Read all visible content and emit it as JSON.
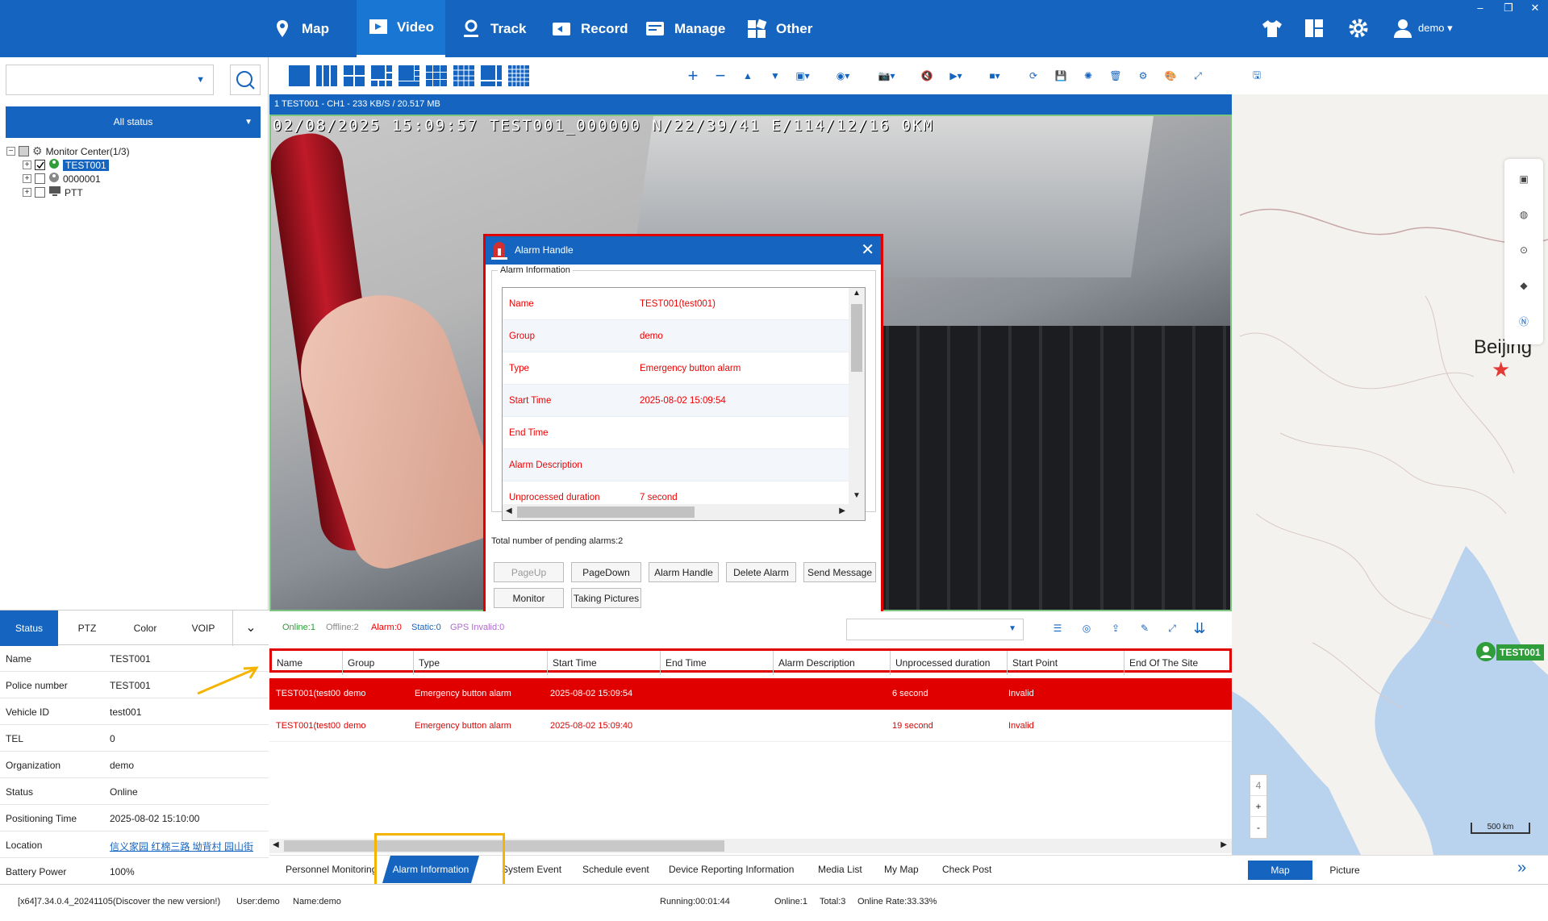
{
  "nav": {
    "map": "Map",
    "video": "Video",
    "track": "Track",
    "record": "Record",
    "manage": "Manage",
    "other": "Other",
    "user": "demo"
  },
  "left": {
    "status_select": "All status",
    "tree": {
      "root": "Monitor Center(1/3)",
      "items": [
        "TEST001",
        "0000001",
        "PTT"
      ]
    }
  },
  "leftTabs": [
    "Status",
    "PTZ",
    "Color",
    "VOIP"
  ],
  "info": [
    {
      "k": "Name",
      "v": "TEST001"
    },
    {
      "k": "Police number",
      "v": "TEST001"
    },
    {
      "k": "Vehicle ID",
      "v": "test001"
    },
    {
      "k": "TEL",
      "v": "0"
    },
    {
      "k": "Organization",
      "v": "demo"
    },
    {
      "k": "Status",
      "v": "Online"
    },
    {
      "k": "Positioning Time",
      "v": "2025-08-02 15:10:00"
    },
    {
      "k": "Location",
      "v": "信义家园 红棉三路 坳背村 园山街"
    },
    {
      "k": "Battery Power",
      "v": "100%"
    }
  ],
  "video": {
    "header": "1  TEST001 - CH1 - 233 KB/S / 20.517 MB",
    "osd": "02/08/2025  15:09:57  TEST001_000000  N/22/39/41  E/114/12/16  0KM"
  },
  "dialog": {
    "title": "Alarm Handle",
    "group_label": "Alarm Information",
    "rows": [
      {
        "k": "Name",
        "v": "TEST001(test001)"
      },
      {
        "k": "Group",
        "v": "demo"
      },
      {
        "k": "Type",
        "v": "Emergency button alarm"
      },
      {
        "k": "Start Time",
        "v": "2025-08-02 15:09:54"
      },
      {
        "k": "End Time",
        "v": ""
      },
      {
        "k": "Alarm Description",
        "v": ""
      },
      {
        "k": "Unprocessed duration",
        "v": "7 second"
      }
    ],
    "pending": "Total number of pending alarms:2",
    "buttons": [
      "PageUp",
      "PageDown",
      "Alarm Handle",
      "Delete Alarm",
      "Send Message",
      "Monitor",
      "Taking Pictures"
    ]
  },
  "counts": {
    "online": "Online:1",
    "offline": "Offline:2",
    "alarm": "Alarm:0",
    "static": "Static:0",
    "gps": "GPS Invalid:0"
  },
  "table": {
    "columns": [
      "Name",
      "Group",
      "Type",
      "Start Time",
      "End Time",
      "Alarm Description",
      "Unprocessed duration",
      "Start Point",
      "End Of The Site"
    ],
    "rows": [
      [
        "TEST001(test00",
        "demo",
        "Emergency button alarm",
        "2025-08-02 15:09:54",
        "",
        "",
        "6 second",
        "Invalid",
        ""
      ],
      [
        "TEST001(test00",
        "demo",
        "Emergency button alarm",
        "2025-08-02 15:09:40",
        "",
        "",
        "19 second",
        "Invalid",
        ""
      ]
    ]
  },
  "bottomTabs": [
    "Personnel Monitoring",
    "Alarm Information",
    "System Event",
    "Schedule event",
    "Device Reporting Information",
    "Media List",
    "My Map",
    "Check Post"
  ],
  "map": {
    "city": "Beijing",
    "marker": "TEST001",
    "zoom": "4",
    "zoom_in": "+",
    "zoom_out": "-",
    "scale": "500 km",
    "tabs": [
      "Map",
      "Picture"
    ]
  },
  "status": {
    "version": "[x64]7.34.0.4_20241105(Discover the new version!)",
    "user": "User:demo",
    "name": "Name:demo",
    "running": "Running:00:01:44",
    "online": "Online:1",
    "total": "Total:3",
    "rate": "Online Rate:33.33%"
  },
  "colors": {
    "primary": "#1565c0",
    "alarm_red": "#e00000",
    "highlight": "#ffc107"
  }
}
